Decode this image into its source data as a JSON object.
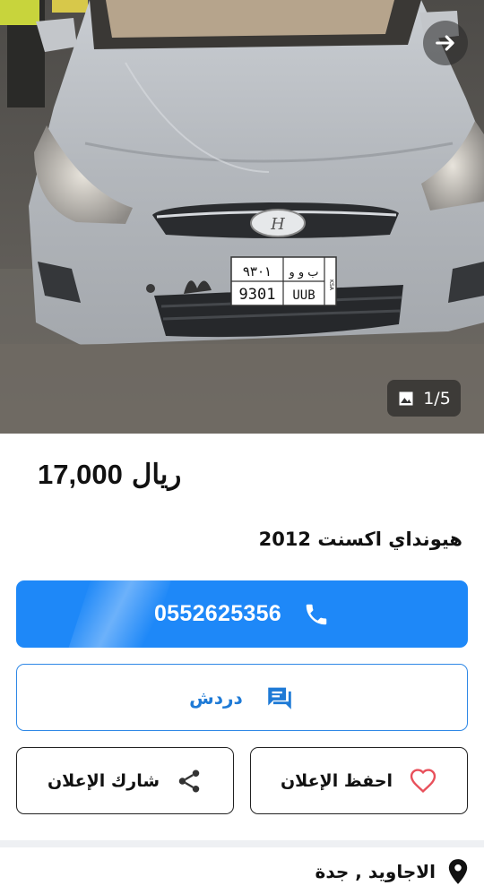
{
  "listing": {
    "image_counter": "1/5",
    "price": "17,000",
    "currency": "ريال",
    "title": "هيونداي اكسنت 2012",
    "location": "الاجاويد , جدة"
  },
  "plate": {
    "arabic_digits": "٩٣٠١",
    "arabic_letters": "ب و و",
    "latin_digits": "9301",
    "latin_letters": "UUB",
    "country": "KSA"
  },
  "actions": {
    "call_number": "0552625356",
    "chat_label": "دردش",
    "share_label": "شارك الإعلان",
    "save_label": "احفظ الإعلان"
  },
  "icons": {
    "next": "arrow-right-icon",
    "gallery": "image-icon",
    "call": "phone-icon",
    "chat": "chat-icon",
    "share": "share-icon",
    "save": "heart-icon",
    "location": "location-pin-icon"
  },
  "colors": {
    "primary": "#1e88f8",
    "outline_blue": "#2f88e6",
    "heart": "#e8505b",
    "car_silver": "#b9bdc2"
  }
}
